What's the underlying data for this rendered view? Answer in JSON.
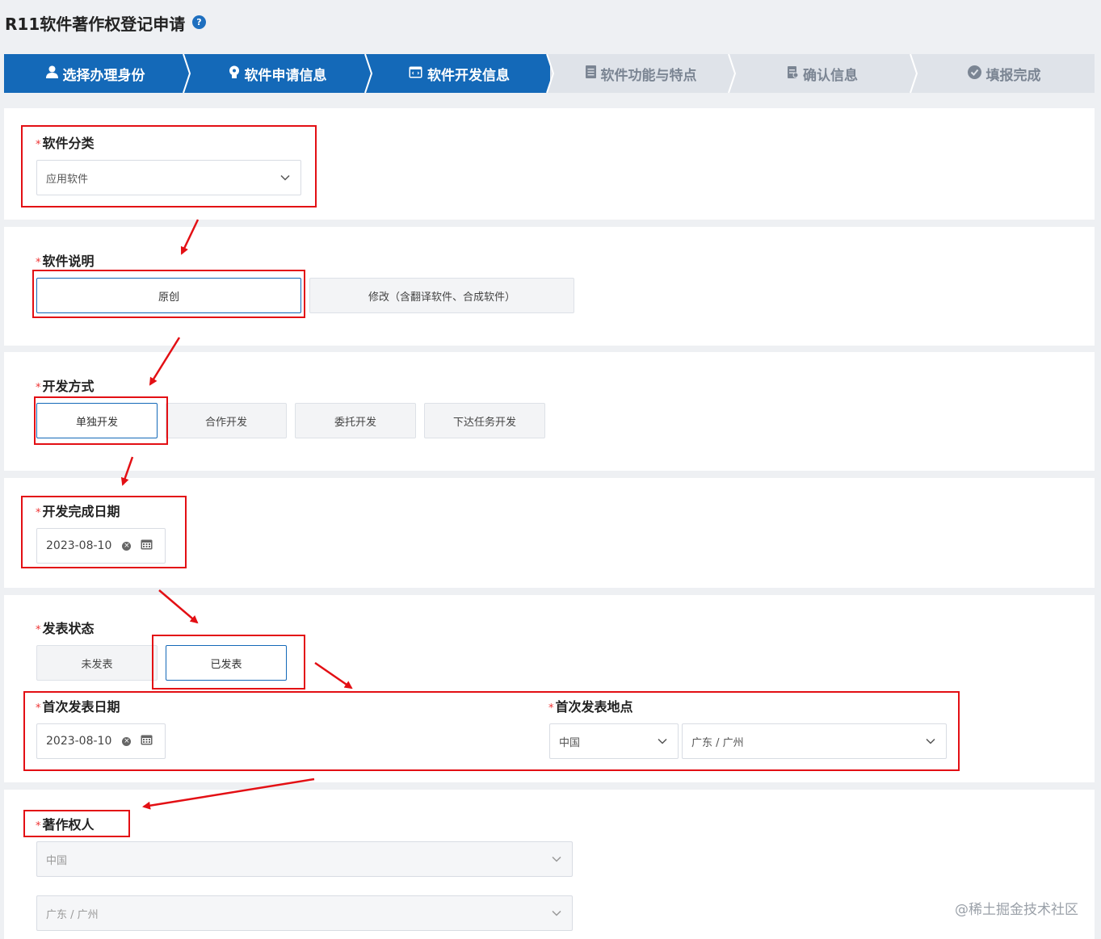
{
  "header": {
    "title": "R11软件著作权登记申请",
    "help_icon": "?"
  },
  "steps": [
    {
      "label": "选择办理身份",
      "icon": "user-icon",
      "state": "active"
    },
    {
      "label": "软件申请信息",
      "icon": "bulb-icon",
      "state": "active"
    },
    {
      "label": "软件开发信息",
      "icon": "window-icon",
      "state": "active"
    },
    {
      "label": "软件功能与特点",
      "icon": "document-icon",
      "state": "inactive"
    },
    {
      "label": "确认信息",
      "icon": "clipboard-icon",
      "state": "inactive"
    },
    {
      "label": "填报完成",
      "icon": "check-circle-icon",
      "state": "inactive"
    }
  ],
  "form": {
    "required_mark": "*",
    "software_category": {
      "label": "软件分类",
      "value": "应用软件"
    },
    "software_description": {
      "label": "软件说明",
      "options": [
        "原创",
        "修改（含翻译软件、合成软件）"
      ],
      "selected": "原创"
    },
    "development_mode": {
      "label": "开发方式",
      "options": [
        "单独开发",
        "合作开发",
        "委托开发",
        "下达任务开发"
      ],
      "selected": "单独开发"
    },
    "completion_date": {
      "label": "开发完成日期",
      "value": "2023-08-10"
    },
    "publish_status": {
      "label": "发表状态",
      "options": [
        "未发表",
        "已发表"
      ],
      "selected": "已发表"
    },
    "first_publish_date": {
      "label": "首次发表日期",
      "value": "2023-08-10"
    },
    "first_publish_place": {
      "label": "首次发表地点",
      "country": "中国",
      "city": "广东 / 广州"
    },
    "copyright_owner": {
      "label": "著作权人",
      "country": "中国",
      "city": "广东 / 广州"
    }
  },
  "watermark": "@稀土掘金技术社区",
  "colors": {
    "primary": "#1469b8",
    "annotation_red": "#e30f14",
    "required": "#e33333"
  }
}
